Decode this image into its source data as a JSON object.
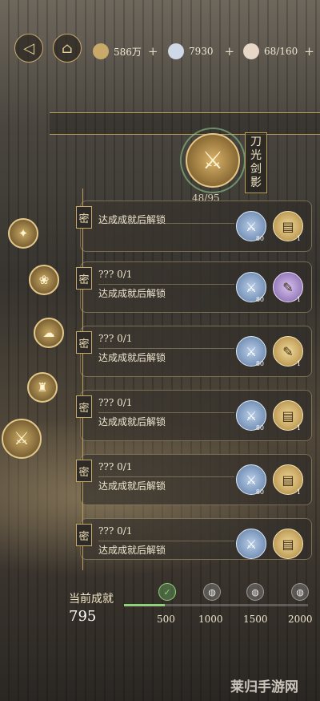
{
  "topbar": {
    "resources": [
      {
        "icon": "coin-icon",
        "value": "586万",
        "color": "#c9a96a"
      },
      {
        "icon": "pearl-icon",
        "value": "7930",
        "color": "#cfd8e6"
      },
      {
        "icon": "stamina-icon",
        "value": "68/160",
        "color": "#e7d7c6"
      }
    ],
    "plus": "+"
  },
  "medal": {
    "title": "刀光剑影",
    "progress": "48/95",
    "glyph": "⚔"
  },
  "rows": [
    {
      "seal": "密",
      "line1": "",
      "line2": "达成成就后解锁",
      "rewards": [
        {
          "type": "blue",
          "glyph": "⚔",
          "count": "80"
        },
        {
          "type": "gold",
          "glyph": "▤",
          "count": "1"
        }
      ]
    },
    {
      "seal": "密",
      "line1": "??? 0/1",
      "line2": "达成成就后解锁",
      "rewards": [
        {
          "type": "blue",
          "glyph": "⚔",
          "count": "80"
        },
        {
          "type": "purple",
          "glyph": "✎",
          "count": "1"
        }
      ]
    },
    {
      "seal": "密",
      "line1": "??? 0/1",
      "line2": "达成成就后解锁",
      "rewards": [
        {
          "type": "blue",
          "glyph": "⚔",
          "count": "80"
        },
        {
          "type": "gold",
          "glyph": "✎",
          "count": "1"
        }
      ]
    },
    {
      "seal": "密",
      "line1": "??? 0/1",
      "line2": "达成成就后解锁",
      "rewards": [
        {
          "type": "blue",
          "glyph": "⚔",
          "count": "80"
        },
        {
          "type": "gold",
          "glyph": "▤",
          "count": "1"
        }
      ]
    },
    {
      "seal": "密",
      "line1": "??? 0/1",
      "line2": "达成成就后解锁",
      "rewards": [
        {
          "type": "blue",
          "glyph": "⚔",
          "count": "80"
        },
        {
          "type": "gold",
          "glyph": "▤",
          "count": "1"
        }
      ]
    },
    {
      "seal": "密",
      "line1": "??? 0/1",
      "line2": "达成成就后解锁",
      "rewards": [
        {
          "type": "blue",
          "glyph": "⚔",
          "count": ""
        },
        {
          "type": "gold",
          "glyph": "▤",
          "count": ""
        }
      ]
    }
  ],
  "footer": {
    "label": "当前成就",
    "value": "795",
    "progress_fraction": 0.22,
    "milestones": [
      "500",
      "1000",
      "1500",
      "2000"
    ]
  },
  "watermark": "莱归手游网"
}
